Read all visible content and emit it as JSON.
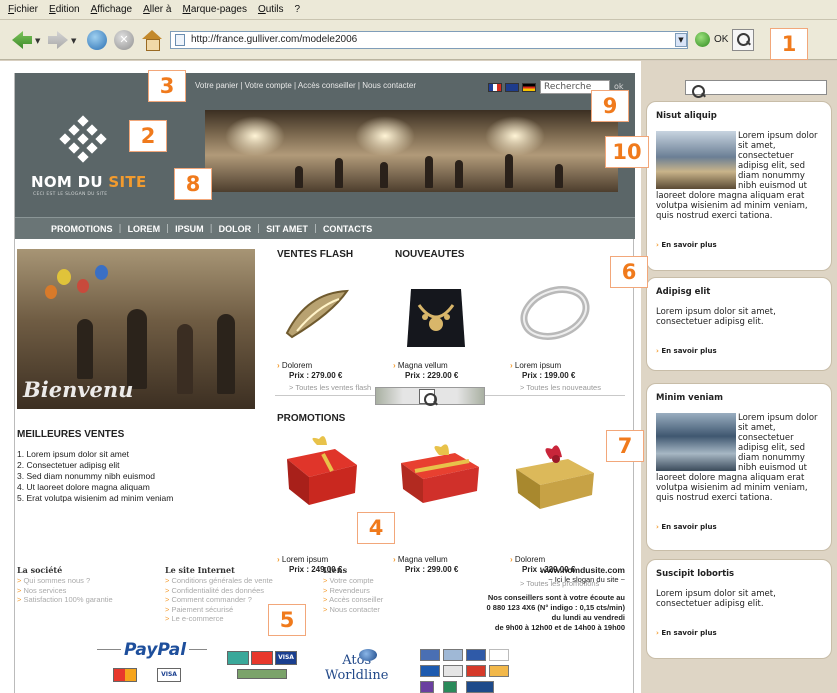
{
  "browser": {
    "menu": [
      "Fichier",
      "Edition",
      "Affichage",
      "Aller à",
      "Marque-pages",
      "Outils",
      "?"
    ],
    "url": "http://france.gulliver.com/modele2006",
    "go_label": "OK"
  },
  "callouts": [
    "1",
    "2",
    "3",
    "4",
    "5",
    "6",
    "7",
    "8",
    "9",
    "10"
  ],
  "header": {
    "util_links": "Votre panier | Votre compte | Accès conseiller | Nous contacter",
    "search_placeholder": "Recherche",
    "ok_label": "ok",
    "site_name_1": "NOM DU ",
    "site_name_2": "SITE",
    "slogan": "CECI EST LE SLOGAN DU SITE"
  },
  "nav": [
    "PROMOTIONS",
    "LOREM",
    "IPSUM",
    "DOLOR",
    "SIT AMET",
    "CONTACTS"
  ],
  "welcome": "Bienvenu",
  "best_sales": {
    "title": "MEILLEURES VENTES",
    "items": [
      "1. Lorem ipsum dolor sit amet",
      "2. Consectetuer adipisg elit",
      "3. Sed diam nonummy nibh euismod",
      "4. Ut laoreet dolore magna aliquam",
      "5. Erat volutpa wisienim ad minim veniam"
    ]
  },
  "flash": {
    "title": "VENTES FLASH",
    "title2": "NOUVEAUTES",
    "products": [
      {
        "name": "Dolorem",
        "price": "Prix : 279.00 €"
      },
      {
        "name": "Magna vellum",
        "price": "Prix : 229.00 €"
      },
      {
        "name": "Lorem ipsum",
        "price": "Prix : 199.00 €"
      }
    ],
    "link_all_flash": "> Toutes les ventes flash",
    "link_all_new": "> Toutes les nouveautes"
  },
  "promos": {
    "title": "PROMOTIONS",
    "products": [
      {
        "name": "Lorem ipsum",
        "price": "Prix : 249.00 €"
      },
      {
        "name": "Magna vellum",
        "price": "Prix : 299.00 €"
      },
      {
        "name": "Dolorem",
        "price": "Prix : 329.00 €"
      }
    ],
    "link_all": "> Toutes les promotions"
  },
  "footer": {
    "cols": [
      {
        "title": "La société",
        "items": [
          "Qui sommes nous ?",
          "Nos services",
          "Satisfaction 100% garantie"
        ]
      },
      {
        "title": "Le site Internet",
        "items": [
          "Conditions générales de vente",
          "Confidentialité des données",
          "Comment commander ?",
          "Paiement sécurisé",
          "Le e-commerce"
        ]
      },
      {
        "title": "Liens",
        "items": [
          "Votre compte",
          "Revendeurs",
          "Accès conseiller",
          "Nous contacter"
        ]
      }
    ],
    "url": "www.nomdusite.com",
    "slogan": "~ Ici le slogan du site ~",
    "contact_1": "Nos conseillers sont à votre écoute au",
    "contact_2": "0 880 123 4X6 (N° indigo : 0,15 cts/min)",
    "contact_3": "du lundi au vendredi",
    "contact_4": "de 9h00 à 12h00 et de 14h00 à 19h00",
    "paypal": "PayPal",
    "atos_1": "Atos",
    "atos_2": "Worldline",
    "cards": [
      "MasterCard",
      "VISA"
    ]
  },
  "sidebar": {
    "panels": [
      {
        "title": "Nisut aliquip",
        "body": "Lorem ipsum dolor sit amet, consectetuer adipisg elit, sed diam nonummy nibh euismod ut laoreet dolore magna aliquam erat volutpa wisienim ad minim veniam, quis nostrud exerci tationa.",
        "more": "En savoir plus"
      },
      {
        "title": "Adipisg elit",
        "body": "Lorem ipsum dolor sit amet, consectetuer adipisg elit.",
        "more": "En savoir plus"
      },
      {
        "title": "Minim veniam",
        "body": "Lorem ipsum dolor sit amet, consectetuer adipisg elit, sed diam nonummy nibh euismod ut laoreet dolore magna aliquam erat volutpa wisienim ad minim veniam, quis nostrud exerci tationa.",
        "more": "En savoir plus"
      },
      {
        "title": "Suscipit lobortis",
        "body": "Lorem ipsum dolor sit amet, consectetuer adipisg elit.",
        "more": "En savoir plus"
      }
    ]
  }
}
